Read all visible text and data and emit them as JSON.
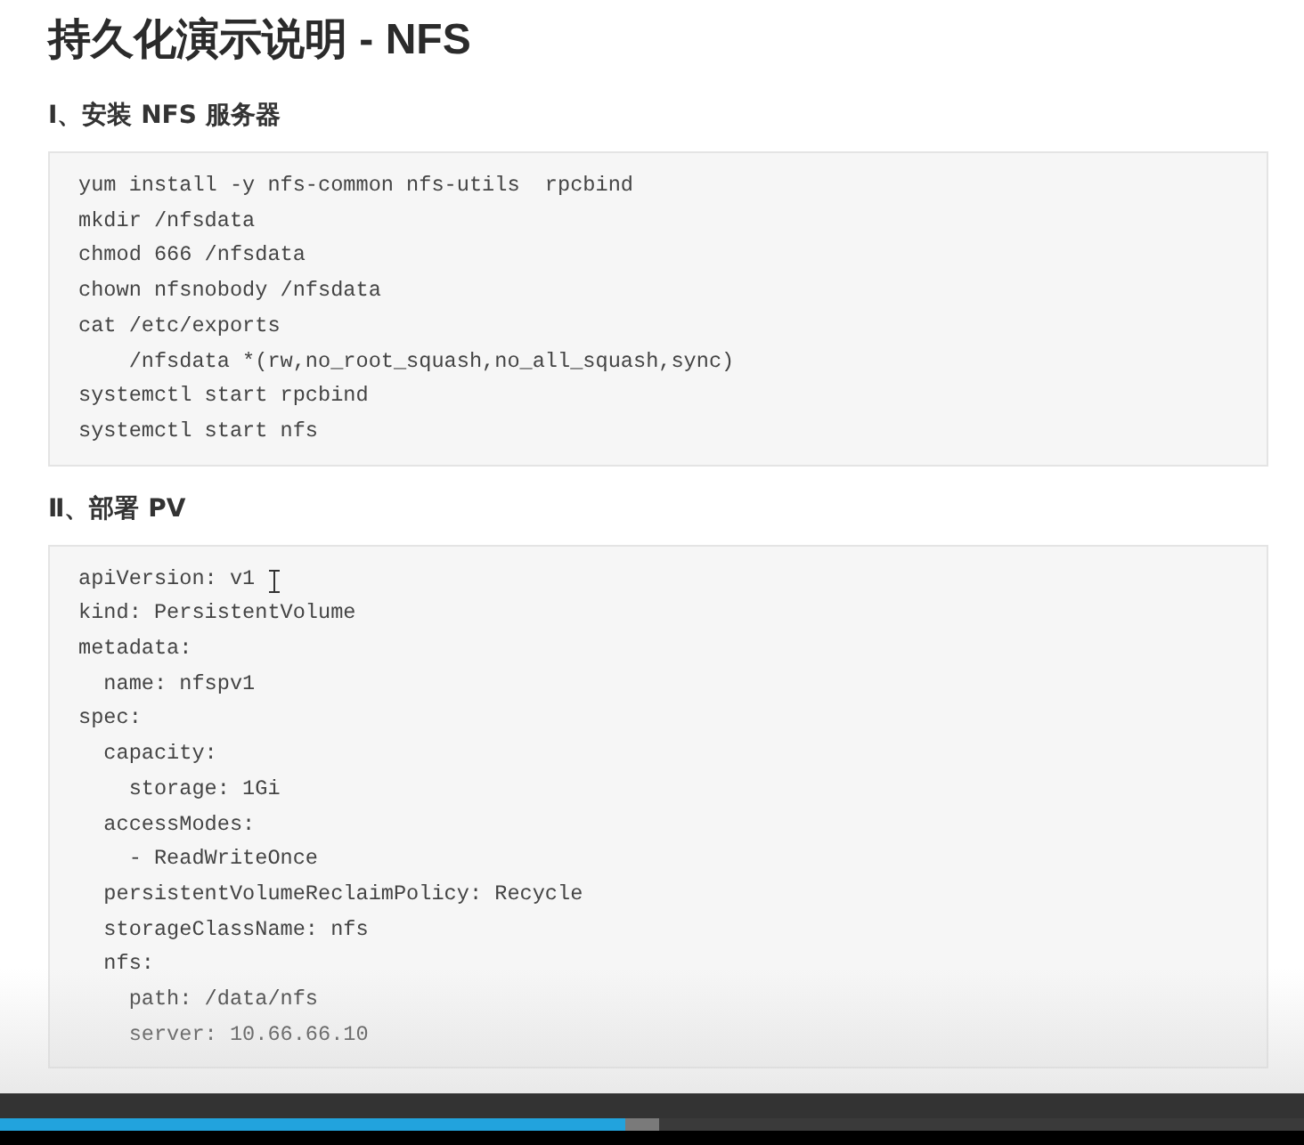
{
  "title": "持久化演示说明 - NFS",
  "sections": [
    {
      "heading": "Ⅰ、安装 NFS 服务器",
      "code": [
        "yum install -y nfs-common nfs-utils  rpcbind",
        "mkdir /nfsdata",
        "chmod 666 /nfsdata",
        "chown nfsnobody /nfsdata",
        "cat /etc/exports",
        "    /nfsdata *(rw,no_root_squash,no_all_squash,sync)",
        "systemctl start rpcbind",
        "systemctl start nfs"
      ]
    },
    {
      "heading": "Ⅱ、部署 PV",
      "code": [
        "apiVersion: v1",
        "kind: PersistentVolume",
        "metadata:",
        "  name: nfspv1",
        "spec:",
        "  capacity:",
        "    storage: 1Gi",
        "  accessModes:",
        "    - ReadWriteOnce",
        "  persistentVolumeReclaimPolicy: Recycle",
        "  storageClassName: nfs",
        "  nfs:",
        "    path: /data/nfs",
        "    server: 10.66.66.10"
      ]
    }
  ],
  "player": {
    "progress": {
      "level": 0.48
    }
  }
}
